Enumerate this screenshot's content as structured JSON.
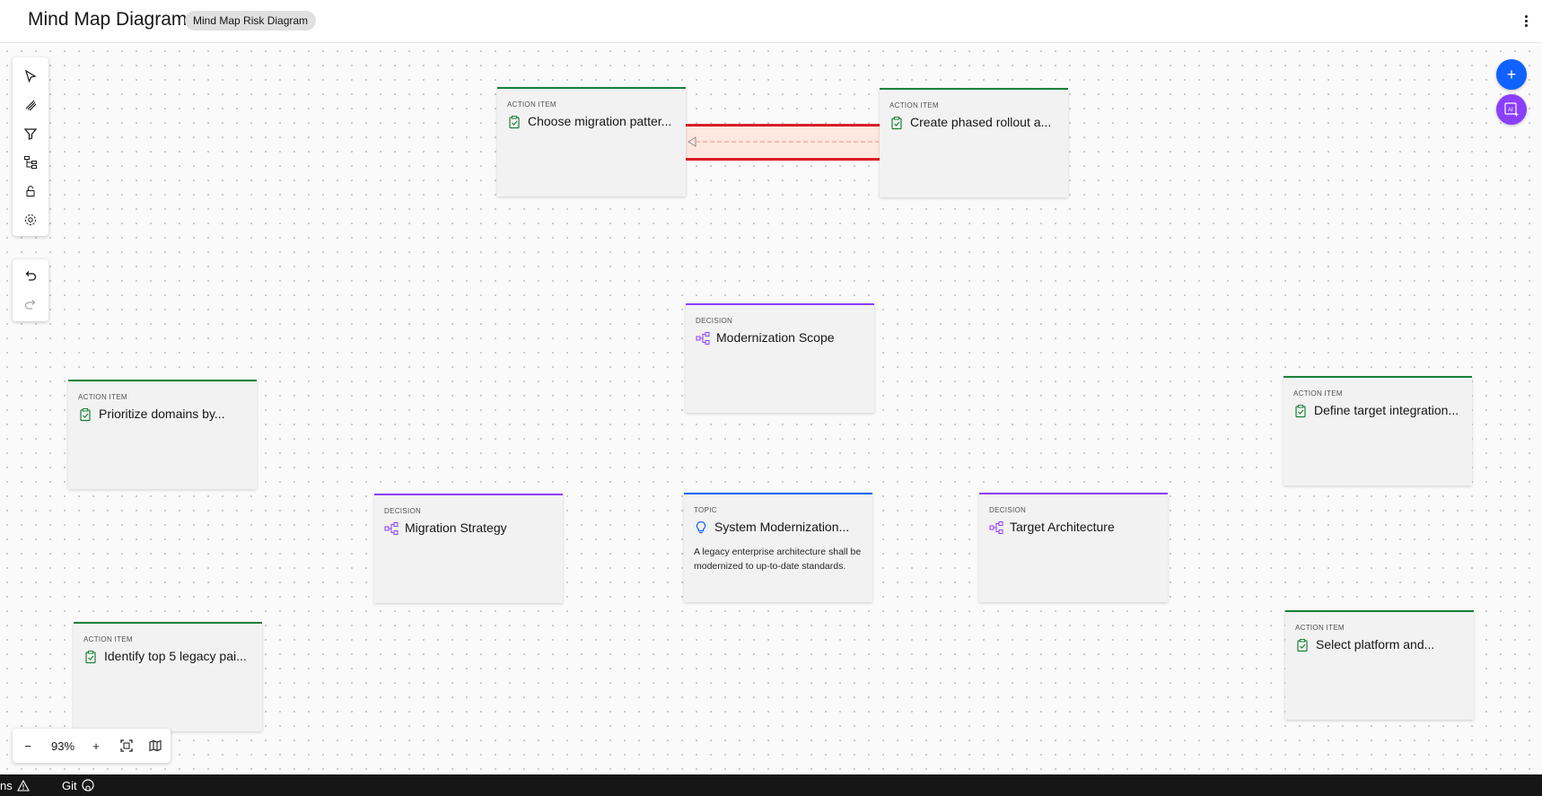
{
  "header": {
    "title": "Mind Map Diagram",
    "tag": "Mind Map Risk Diagram"
  },
  "left_toolbar": {
    "tools": [
      "pointer-icon",
      "pen-icon",
      "filter-icon",
      "hierarchy-icon",
      "lock-icon",
      "settings-icon"
    ],
    "history": [
      "undo-icon",
      "redo-icon"
    ]
  },
  "nodes": [
    {
      "id": "n1",
      "type": "ACTION ITEM",
      "title": "Choose migration patter..."
    },
    {
      "id": "n2",
      "type": "ACTION ITEM",
      "title": "Create phased rollout a..."
    },
    {
      "id": "n3",
      "type": "DECISION",
      "title": "Modernization Scope"
    },
    {
      "id": "n4",
      "type": "ACTION ITEM",
      "title": "Prioritize domains by..."
    },
    {
      "id": "n5",
      "type": "ACTION ITEM",
      "title": "Define target integration..."
    },
    {
      "id": "n6",
      "type": "DECISION",
      "title": "Migration Strategy"
    },
    {
      "id": "n7",
      "type": "TOPIC",
      "title": "System Modernization...",
      "description": "A legacy enterprise architecture shall be modernized to up-to-date standards."
    },
    {
      "id": "n8",
      "type": "DECISION",
      "title": "Target Architecture"
    },
    {
      "id": "n9",
      "type": "ACTION ITEM",
      "title": "Identify top 5 legacy pai..."
    },
    {
      "id": "n10",
      "type": "ACTION ITEM",
      "title": "Select platform and..."
    }
  ],
  "zoom": {
    "minus": "−",
    "level": "93%",
    "plus": "+"
  },
  "fab": {
    "add": "+",
    "ai": "AI"
  },
  "statusbar": {
    "problems_fragment": "ns",
    "git": "Git"
  },
  "colors": {
    "action": "#198038",
    "decision": "#8a3ffc",
    "topic": "#0f62fe",
    "accent": "#0f62fe",
    "ai": "#8a3ffc",
    "highlight": "#da1e28"
  }
}
